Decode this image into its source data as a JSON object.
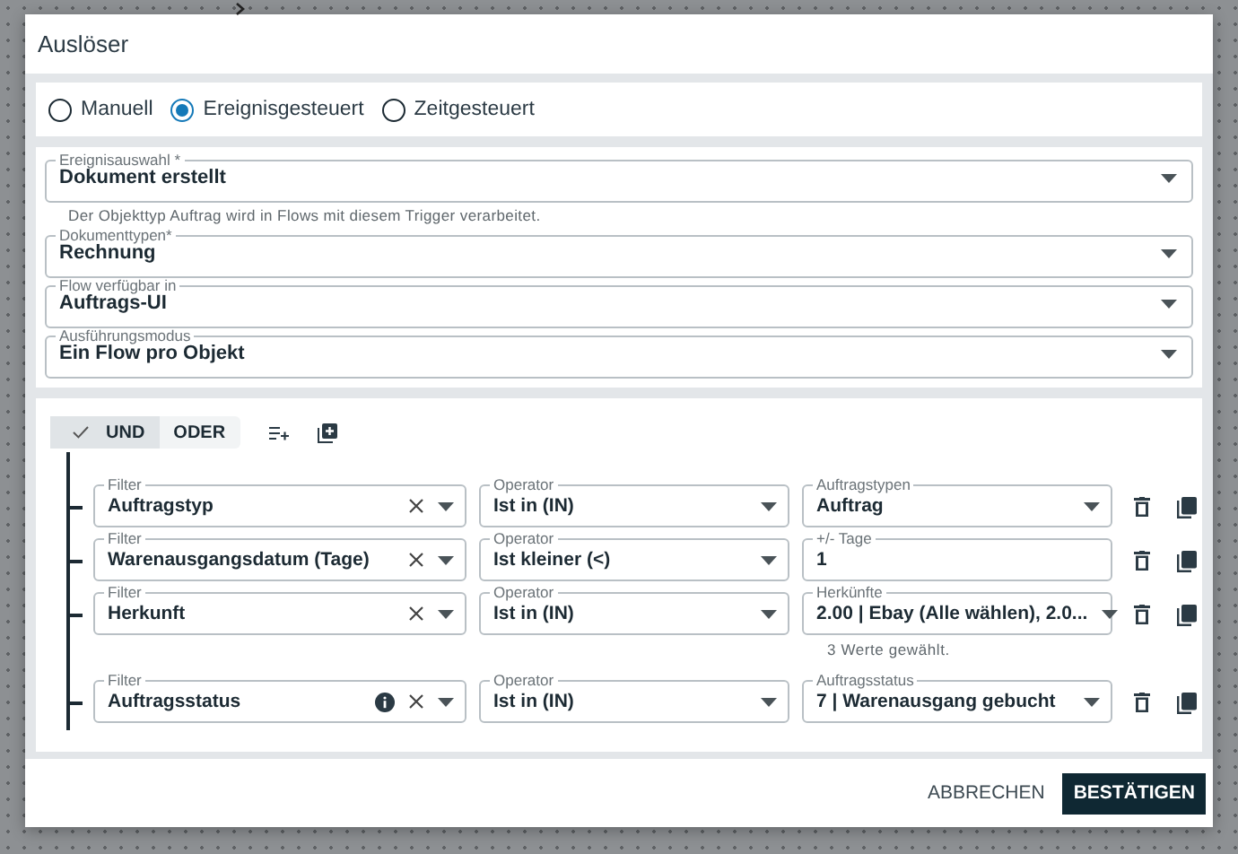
{
  "dialog": {
    "title": "Auslöser"
  },
  "trigger_modes": [
    {
      "label": "Manuell",
      "selected": false
    },
    {
      "label": "Ereignisgesteuert",
      "selected": true
    },
    {
      "label": "Zeitgesteuert",
      "selected": false
    }
  ],
  "fields": [
    {
      "label": "Ereignisauswahl *",
      "value": "Dokument erstellt",
      "helper": "Der Objekttyp Auftrag wird in Flows mit diesem Trigger verarbeitet."
    },
    {
      "label": "Dokumenttypen*",
      "value": "Rechnung"
    },
    {
      "label": "Flow verfügbar in",
      "value": "Auftrags-UI"
    },
    {
      "label": "Ausführungsmodus",
      "value": "Ein Flow pro Objekt"
    }
  ],
  "logic": [
    {
      "label": "UND",
      "selected": true
    },
    {
      "label": "ODER",
      "selected": false
    }
  ],
  "filters": [
    {
      "filter": {
        "label": "Filter",
        "value": "Auftragstyp",
        "info": false
      },
      "operator": {
        "label": "Operator",
        "value": "Ist in (IN)"
      },
      "value": {
        "kind": "select",
        "label": "Auftragstypen",
        "value": "Auftrag"
      }
    },
    {
      "filter": {
        "label": "Filter",
        "value": "Warenausgangsdatum (Tage)",
        "info": false
      },
      "operator": {
        "label": "Operator",
        "value": "Ist kleiner (<)"
      },
      "value": {
        "kind": "text",
        "label": "+/- Tage",
        "value": "1"
      }
    },
    {
      "filter": {
        "label": "Filter",
        "value": "Herkunft",
        "info": false
      },
      "operator": {
        "label": "Operator",
        "value": "Ist in (IN)"
      },
      "value": {
        "kind": "select",
        "label": "Herkünfte",
        "value": "2.00 | Ebay (Alle wählen), 2.0...",
        "helper": "3 Werte gewählt."
      }
    },
    {
      "filter": {
        "label": "Filter",
        "value": "Auftragsstatus",
        "info": true
      },
      "operator": {
        "label": "Operator",
        "value": "Ist in (IN)"
      },
      "value": {
        "kind": "select",
        "label": "Auftragsstatus",
        "value": "7 | Warenausgang gebucht"
      }
    }
  ],
  "buttons": [
    {
      "label": "ABBRECHEN",
      "kind": "text"
    },
    {
      "label": "BESTÄTIGEN",
      "kind": "primary"
    }
  ]
}
